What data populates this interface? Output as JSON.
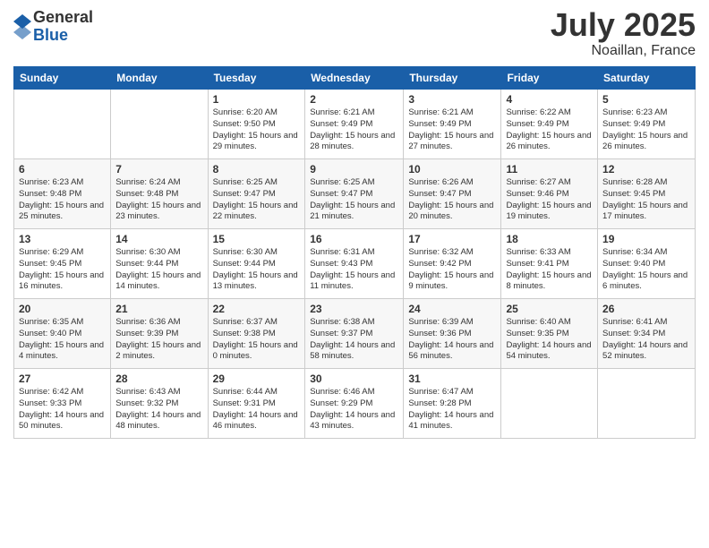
{
  "header": {
    "logo_general": "General",
    "logo_blue": "Blue",
    "month": "July 2025",
    "location": "Noaillan, France"
  },
  "days_of_week": [
    "Sunday",
    "Monday",
    "Tuesday",
    "Wednesday",
    "Thursday",
    "Friday",
    "Saturday"
  ],
  "weeks": [
    [
      {
        "day": "",
        "content": ""
      },
      {
        "day": "",
        "content": ""
      },
      {
        "day": "1",
        "content": "Sunrise: 6:20 AM\nSunset: 9:50 PM\nDaylight: 15 hours\nand 29 minutes."
      },
      {
        "day": "2",
        "content": "Sunrise: 6:21 AM\nSunset: 9:49 PM\nDaylight: 15 hours\nand 28 minutes."
      },
      {
        "day": "3",
        "content": "Sunrise: 6:21 AM\nSunset: 9:49 PM\nDaylight: 15 hours\nand 27 minutes."
      },
      {
        "day": "4",
        "content": "Sunrise: 6:22 AM\nSunset: 9:49 PM\nDaylight: 15 hours\nand 26 minutes."
      },
      {
        "day": "5",
        "content": "Sunrise: 6:23 AM\nSunset: 9:49 PM\nDaylight: 15 hours\nand 26 minutes."
      }
    ],
    [
      {
        "day": "6",
        "content": "Sunrise: 6:23 AM\nSunset: 9:48 PM\nDaylight: 15 hours\nand 25 minutes."
      },
      {
        "day": "7",
        "content": "Sunrise: 6:24 AM\nSunset: 9:48 PM\nDaylight: 15 hours\nand 23 minutes."
      },
      {
        "day": "8",
        "content": "Sunrise: 6:25 AM\nSunset: 9:47 PM\nDaylight: 15 hours\nand 22 minutes."
      },
      {
        "day": "9",
        "content": "Sunrise: 6:25 AM\nSunset: 9:47 PM\nDaylight: 15 hours\nand 21 minutes."
      },
      {
        "day": "10",
        "content": "Sunrise: 6:26 AM\nSunset: 9:47 PM\nDaylight: 15 hours\nand 20 minutes."
      },
      {
        "day": "11",
        "content": "Sunrise: 6:27 AM\nSunset: 9:46 PM\nDaylight: 15 hours\nand 19 minutes."
      },
      {
        "day": "12",
        "content": "Sunrise: 6:28 AM\nSunset: 9:45 PM\nDaylight: 15 hours\nand 17 minutes."
      }
    ],
    [
      {
        "day": "13",
        "content": "Sunrise: 6:29 AM\nSunset: 9:45 PM\nDaylight: 15 hours\nand 16 minutes."
      },
      {
        "day": "14",
        "content": "Sunrise: 6:30 AM\nSunset: 9:44 PM\nDaylight: 15 hours\nand 14 minutes."
      },
      {
        "day": "15",
        "content": "Sunrise: 6:30 AM\nSunset: 9:44 PM\nDaylight: 15 hours\nand 13 minutes."
      },
      {
        "day": "16",
        "content": "Sunrise: 6:31 AM\nSunset: 9:43 PM\nDaylight: 15 hours\nand 11 minutes."
      },
      {
        "day": "17",
        "content": "Sunrise: 6:32 AM\nSunset: 9:42 PM\nDaylight: 15 hours\nand 9 minutes."
      },
      {
        "day": "18",
        "content": "Sunrise: 6:33 AM\nSunset: 9:41 PM\nDaylight: 15 hours\nand 8 minutes."
      },
      {
        "day": "19",
        "content": "Sunrise: 6:34 AM\nSunset: 9:40 PM\nDaylight: 15 hours\nand 6 minutes."
      }
    ],
    [
      {
        "day": "20",
        "content": "Sunrise: 6:35 AM\nSunset: 9:40 PM\nDaylight: 15 hours\nand 4 minutes."
      },
      {
        "day": "21",
        "content": "Sunrise: 6:36 AM\nSunset: 9:39 PM\nDaylight: 15 hours\nand 2 minutes."
      },
      {
        "day": "22",
        "content": "Sunrise: 6:37 AM\nSunset: 9:38 PM\nDaylight: 15 hours\nand 0 minutes."
      },
      {
        "day": "23",
        "content": "Sunrise: 6:38 AM\nSunset: 9:37 PM\nDaylight: 14 hours\nand 58 minutes."
      },
      {
        "day": "24",
        "content": "Sunrise: 6:39 AM\nSunset: 9:36 PM\nDaylight: 14 hours\nand 56 minutes."
      },
      {
        "day": "25",
        "content": "Sunrise: 6:40 AM\nSunset: 9:35 PM\nDaylight: 14 hours\nand 54 minutes."
      },
      {
        "day": "26",
        "content": "Sunrise: 6:41 AM\nSunset: 9:34 PM\nDaylight: 14 hours\nand 52 minutes."
      }
    ],
    [
      {
        "day": "27",
        "content": "Sunrise: 6:42 AM\nSunset: 9:33 PM\nDaylight: 14 hours\nand 50 minutes."
      },
      {
        "day": "28",
        "content": "Sunrise: 6:43 AM\nSunset: 9:32 PM\nDaylight: 14 hours\nand 48 minutes."
      },
      {
        "day": "29",
        "content": "Sunrise: 6:44 AM\nSunset: 9:31 PM\nDaylight: 14 hours\nand 46 minutes."
      },
      {
        "day": "30",
        "content": "Sunrise: 6:46 AM\nSunset: 9:29 PM\nDaylight: 14 hours\nand 43 minutes."
      },
      {
        "day": "31",
        "content": "Sunrise: 6:47 AM\nSunset: 9:28 PM\nDaylight: 14 hours\nand 41 minutes."
      },
      {
        "day": "",
        "content": ""
      },
      {
        "day": "",
        "content": ""
      }
    ]
  ]
}
